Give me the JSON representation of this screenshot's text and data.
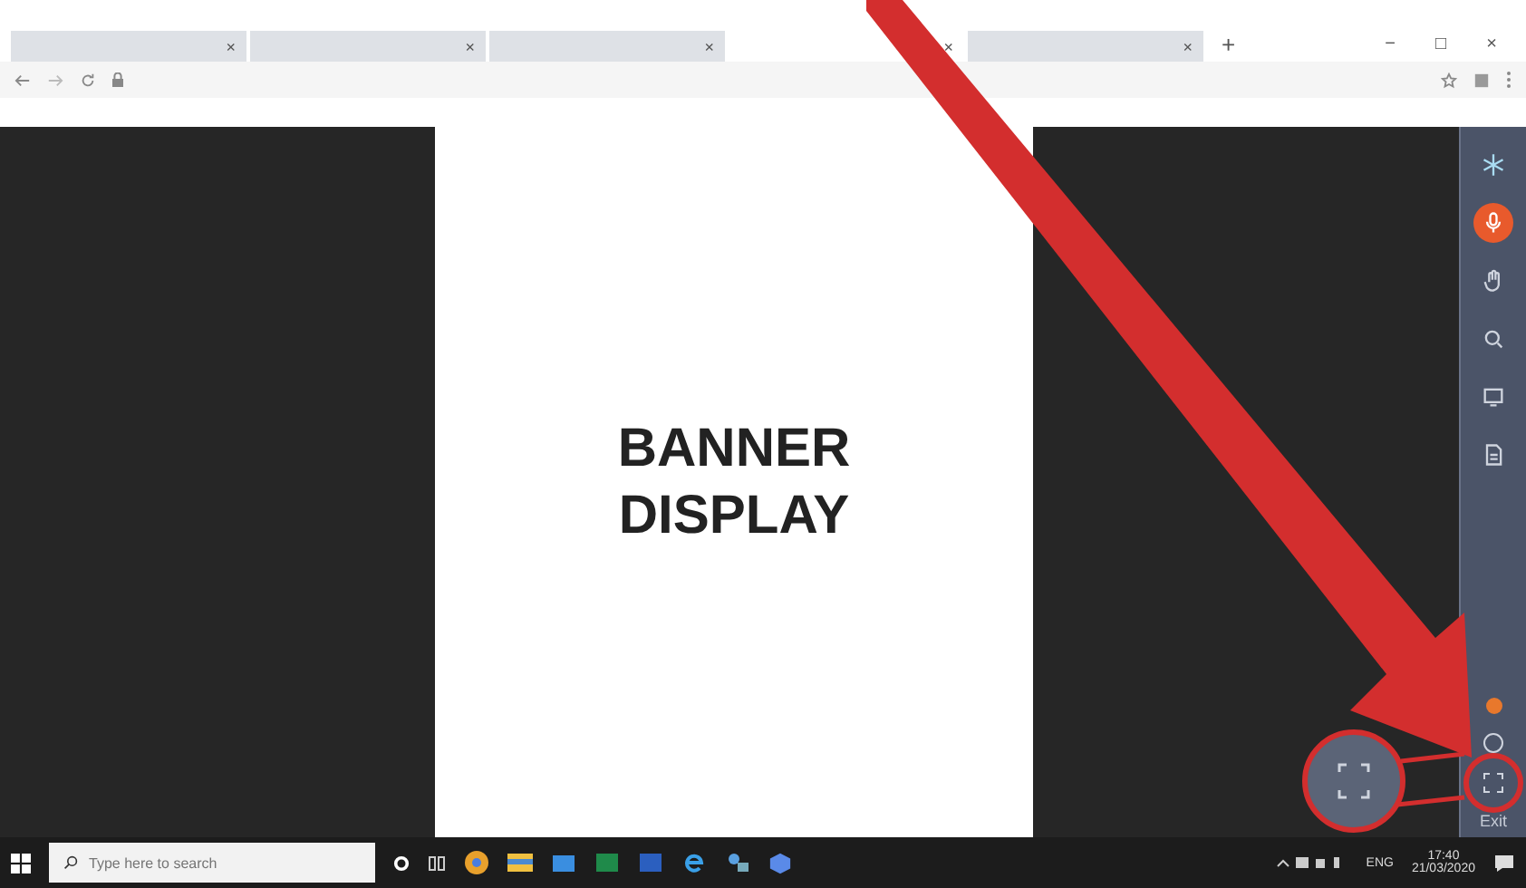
{
  "browser": {
    "tabs": [
      {
        "close": "×",
        "selected": false
      },
      {
        "close": "×",
        "selected": false
      },
      {
        "close": "×",
        "selected": false
      },
      {
        "close": "×",
        "selected": true
      },
      {
        "close": "×",
        "selected": false
      }
    ],
    "new_tab": "+",
    "window_controls": [
      "−",
      "□",
      "×"
    ]
  },
  "banner": {
    "text": "BANNER DISPLAY"
  },
  "sidebar": {
    "tools": [
      {
        "kind": "snowflake",
        "active": false
      },
      {
        "kind": "mic",
        "active": true
      },
      {
        "kind": "hand",
        "active": false
      },
      {
        "kind": "zoom",
        "active": false
      },
      {
        "kind": "screen",
        "active": false
      },
      {
        "kind": "doc",
        "active": false
      }
    ],
    "exit": "Exit"
  },
  "taskbar": {
    "search_placeholder": "Type here to search",
    "language": "ENG",
    "time": "17:40",
    "date": "21/03/2020"
  }
}
